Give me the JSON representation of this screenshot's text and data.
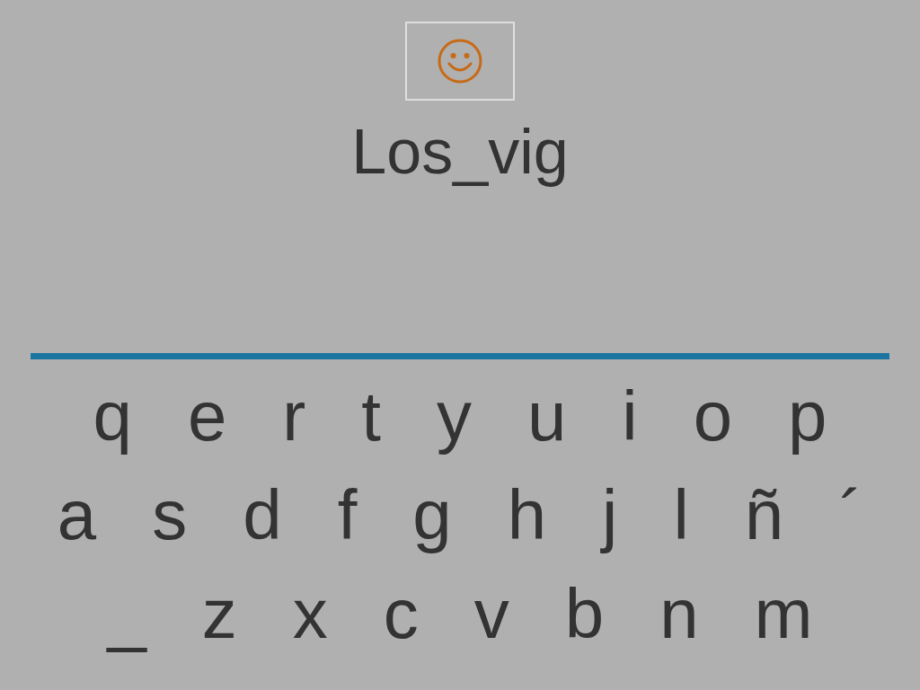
{
  "word": {
    "text": "Los_vig"
  },
  "keyboard": {
    "rows": [
      {
        "keys": [
          "q",
          "e",
          "r",
          "t",
          "y",
          "u",
          "i",
          "o",
          "p"
        ]
      },
      {
        "keys": [
          "a",
          "s",
          "d",
          "f",
          "g",
          "h",
          "j",
          "l",
          "ñ",
          "´"
        ]
      },
      {
        "keys": [
          "_",
          "z",
          "x",
          "c",
          "v",
          "b",
          "n",
          "m"
        ]
      }
    ]
  }
}
